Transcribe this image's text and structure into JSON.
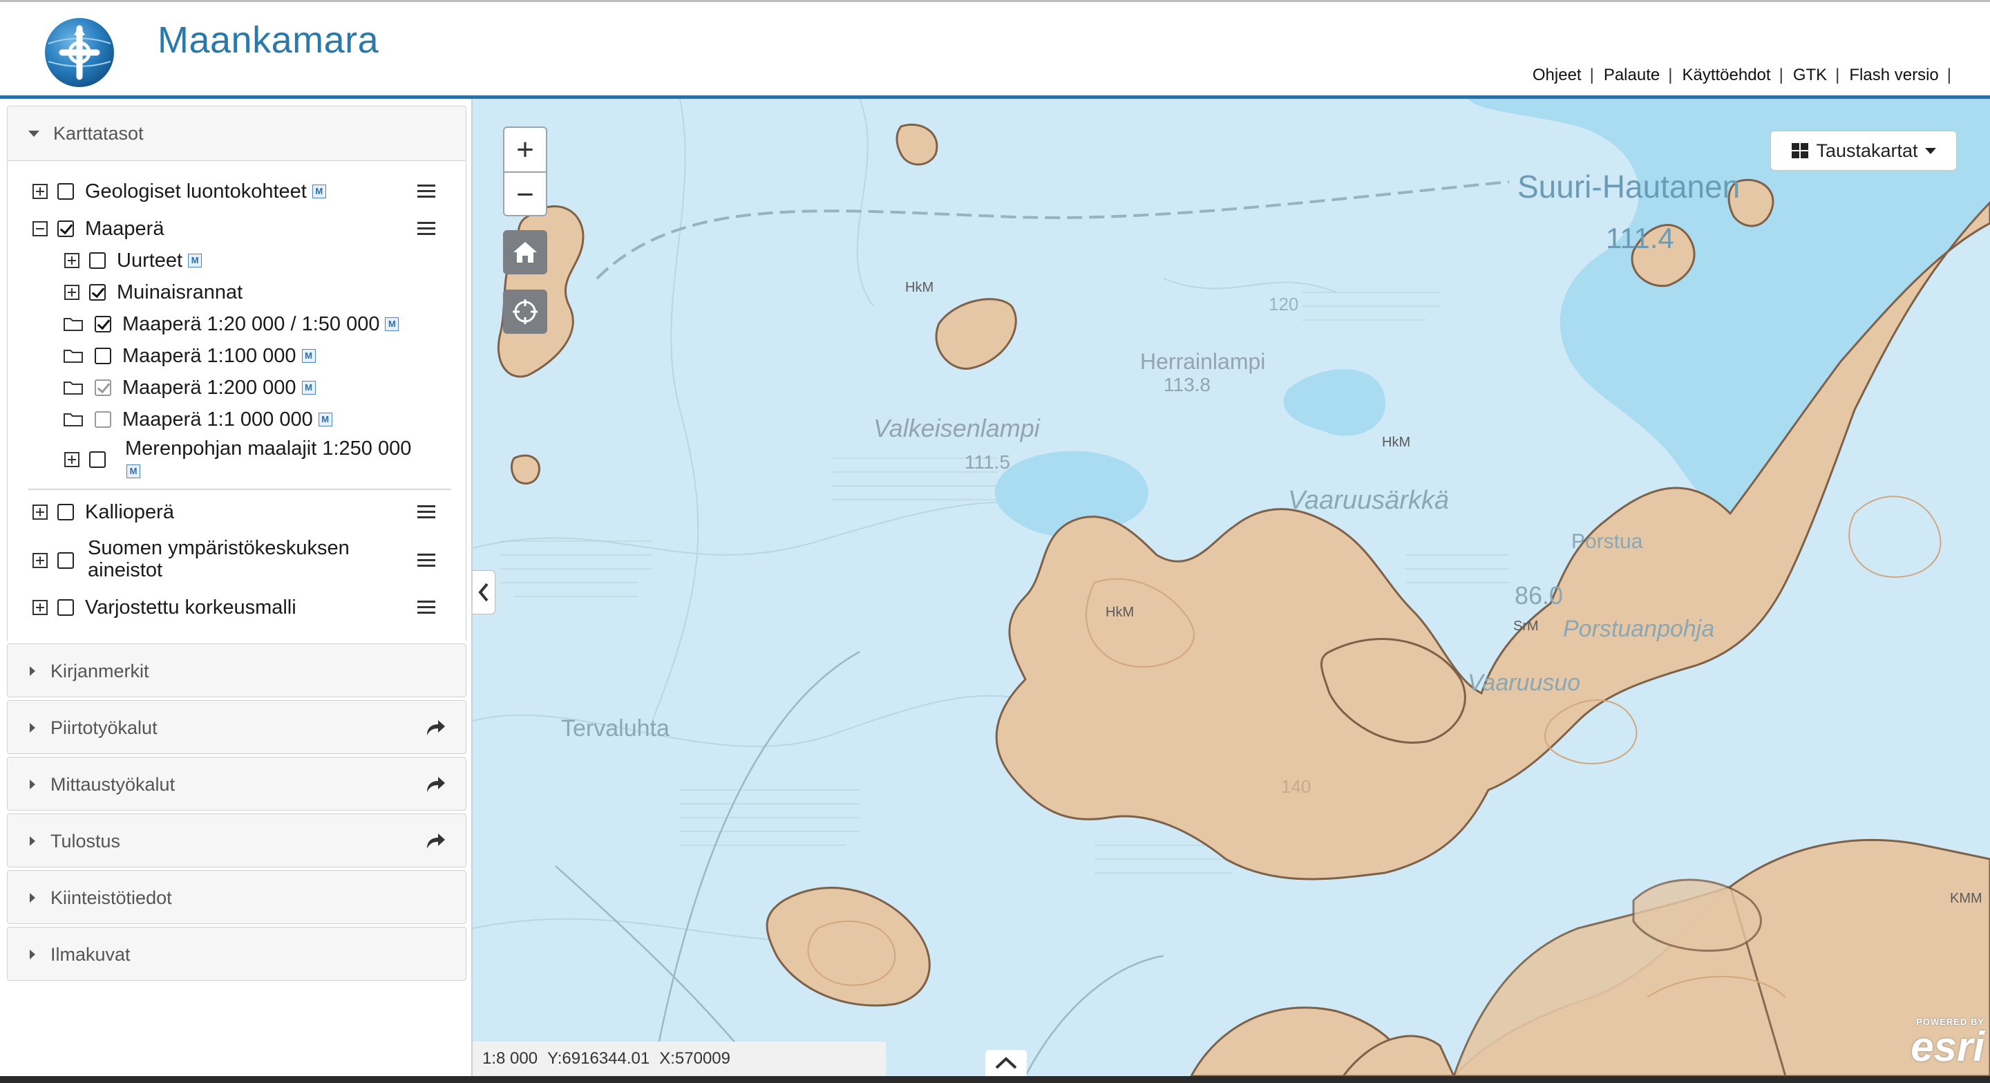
{
  "app": {
    "title": "Maankamara",
    "accent_color": "#2a79ad"
  },
  "header_links": [
    "Ohjeet",
    "Palaute",
    "Käyttöehdot",
    "GTK",
    "Flash versio"
  ],
  "layers_panel": {
    "title": "Karttatasot",
    "items": [
      {
        "label": "Geologiset luontokohteet",
        "checked": false,
        "metadata_icon": "M"
      },
      {
        "label": "Maaperä",
        "checked": true
      },
      {
        "label": "Uurteet",
        "checked": false,
        "metadata_icon": "M"
      },
      {
        "label": "Muinaisrannat",
        "checked": true
      },
      {
        "label": "Maaperä 1:20 000 / 1:50 000",
        "checked": true,
        "metadata_icon": "M"
      },
      {
        "label": "Maaperä 1:100 000",
        "checked": false,
        "metadata_icon": "M"
      },
      {
        "label": "Maaperä 1:200 000",
        "checked": true,
        "disabled": true,
        "metadata_icon": "M"
      },
      {
        "label": "Maaperä 1:1 000 000",
        "checked": false,
        "disabled": true,
        "metadata_icon": "M"
      },
      {
        "label_line1": "Merenpohjan maalajit 1:250 000",
        "checked": false,
        "metadata_icon": "M"
      },
      {
        "label": "Kallioperä",
        "checked": false
      },
      {
        "label_line1": "Suomen ympäristökeskuksen",
        "label_line2": "aineistot",
        "checked": false
      },
      {
        "label": "Varjostettu korkeusmalli",
        "checked": false
      }
    ]
  },
  "collapsed_panels": [
    "Kirjanmerkit",
    "Piirtotyökalut",
    "Mittaustyökalut",
    "Tulostus",
    "Kiinteistötiedot",
    "Ilmakuvat"
  ],
  "map": {
    "zoom_in": "+",
    "zoom_out": "−",
    "basemap_button": "Taustakartat",
    "scale": "1:8 000",
    "y_coord": "Y:6916344.01",
    "x_coord": "X:570009",
    "attribution_small": "POWERED BY",
    "attribution_name": "esri",
    "colors": {
      "water": "#cfeaf6",
      "lake": "#a9dbf1",
      "sand": "#e5c7a5",
      "outline": "#8a6a52"
    },
    "place_labels": [
      "Suuri-Hautanen",
      "111.4",
      "Herrainlampi",
      "113.8",
      "Valkeisenlampi",
      "111.5",
      "Vaaruusärkkä",
      "Porstua",
      "86.0",
      "Porstuanpohja",
      "Vaaruusuo",
      "Tervaluhta",
      "HkM",
      "HkM",
      "HkM",
      "SrM",
      "KMM",
      "120",
      "140"
    ]
  }
}
